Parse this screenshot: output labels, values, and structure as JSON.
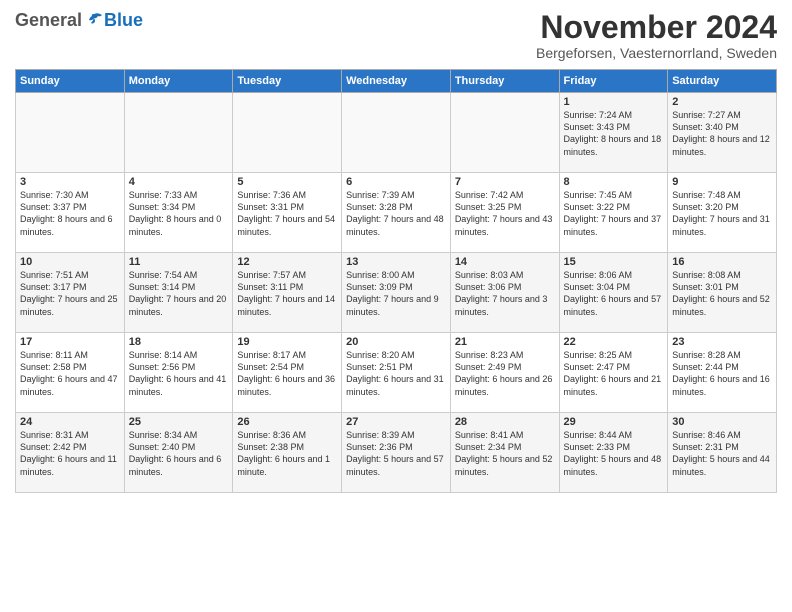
{
  "logo": {
    "general": "General",
    "blue": "Blue"
  },
  "title": "November 2024",
  "location": "Bergeforsen, Vaesternorrland, Sweden",
  "weekdays": [
    "Sunday",
    "Monday",
    "Tuesday",
    "Wednesday",
    "Thursday",
    "Friday",
    "Saturday"
  ],
  "weeks": [
    [
      {
        "day": "",
        "info": ""
      },
      {
        "day": "",
        "info": ""
      },
      {
        "day": "",
        "info": ""
      },
      {
        "day": "",
        "info": ""
      },
      {
        "day": "",
        "info": ""
      },
      {
        "day": "1",
        "info": "Sunrise: 7:24 AM\nSunset: 3:43 PM\nDaylight: 8 hours and 18 minutes."
      },
      {
        "day": "2",
        "info": "Sunrise: 7:27 AM\nSunset: 3:40 PM\nDaylight: 8 hours and 12 minutes."
      }
    ],
    [
      {
        "day": "3",
        "info": "Sunrise: 7:30 AM\nSunset: 3:37 PM\nDaylight: 8 hours and 6 minutes."
      },
      {
        "day": "4",
        "info": "Sunrise: 7:33 AM\nSunset: 3:34 PM\nDaylight: 8 hours and 0 minutes."
      },
      {
        "day": "5",
        "info": "Sunrise: 7:36 AM\nSunset: 3:31 PM\nDaylight: 7 hours and 54 minutes."
      },
      {
        "day": "6",
        "info": "Sunrise: 7:39 AM\nSunset: 3:28 PM\nDaylight: 7 hours and 48 minutes."
      },
      {
        "day": "7",
        "info": "Sunrise: 7:42 AM\nSunset: 3:25 PM\nDaylight: 7 hours and 43 minutes."
      },
      {
        "day": "8",
        "info": "Sunrise: 7:45 AM\nSunset: 3:22 PM\nDaylight: 7 hours and 37 minutes."
      },
      {
        "day": "9",
        "info": "Sunrise: 7:48 AM\nSunset: 3:20 PM\nDaylight: 7 hours and 31 minutes."
      }
    ],
    [
      {
        "day": "10",
        "info": "Sunrise: 7:51 AM\nSunset: 3:17 PM\nDaylight: 7 hours and 25 minutes."
      },
      {
        "day": "11",
        "info": "Sunrise: 7:54 AM\nSunset: 3:14 PM\nDaylight: 7 hours and 20 minutes."
      },
      {
        "day": "12",
        "info": "Sunrise: 7:57 AM\nSunset: 3:11 PM\nDaylight: 7 hours and 14 minutes."
      },
      {
        "day": "13",
        "info": "Sunrise: 8:00 AM\nSunset: 3:09 PM\nDaylight: 7 hours and 9 minutes."
      },
      {
        "day": "14",
        "info": "Sunrise: 8:03 AM\nSunset: 3:06 PM\nDaylight: 7 hours and 3 minutes."
      },
      {
        "day": "15",
        "info": "Sunrise: 8:06 AM\nSunset: 3:04 PM\nDaylight: 6 hours and 57 minutes."
      },
      {
        "day": "16",
        "info": "Sunrise: 8:08 AM\nSunset: 3:01 PM\nDaylight: 6 hours and 52 minutes."
      }
    ],
    [
      {
        "day": "17",
        "info": "Sunrise: 8:11 AM\nSunset: 2:58 PM\nDaylight: 6 hours and 47 minutes."
      },
      {
        "day": "18",
        "info": "Sunrise: 8:14 AM\nSunset: 2:56 PM\nDaylight: 6 hours and 41 minutes."
      },
      {
        "day": "19",
        "info": "Sunrise: 8:17 AM\nSunset: 2:54 PM\nDaylight: 6 hours and 36 minutes."
      },
      {
        "day": "20",
        "info": "Sunrise: 8:20 AM\nSunset: 2:51 PM\nDaylight: 6 hours and 31 minutes."
      },
      {
        "day": "21",
        "info": "Sunrise: 8:23 AM\nSunset: 2:49 PM\nDaylight: 6 hours and 26 minutes."
      },
      {
        "day": "22",
        "info": "Sunrise: 8:25 AM\nSunset: 2:47 PM\nDaylight: 6 hours and 21 minutes."
      },
      {
        "day": "23",
        "info": "Sunrise: 8:28 AM\nSunset: 2:44 PM\nDaylight: 6 hours and 16 minutes."
      }
    ],
    [
      {
        "day": "24",
        "info": "Sunrise: 8:31 AM\nSunset: 2:42 PM\nDaylight: 6 hours and 11 minutes."
      },
      {
        "day": "25",
        "info": "Sunrise: 8:34 AM\nSunset: 2:40 PM\nDaylight: 6 hours and 6 minutes."
      },
      {
        "day": "26",
        "info": "Sunrise: 8:36 AM\nSunset: 2:38 PM\nDaylight: 6 hours and 1 minute."
      },
      {
        "day": "27",
        "info": "Sunrise: 8:39 AM\nSunset: 2:36 PM\nDaylight: 5 hours and 57 minutes."
      },
      {
        "day": "28",
        "info": "Sunrise: 8:41 AM\nSunset: 2:34 PM\nDaylight: 5 hours and 52 minutes."
      },
      {
        "day": "29",
        "info": "Sunrise: 8:44 AM\nSunset: 2:33 PM\nDaylight: 5 hours and 48 minutes."
      },
      {
        "day": "30",
        "info": "Sunrise: 8:46 AM\nSunset: 2:31 PM\nDaylight: 5 hours and 44 minutes."
      }
    ]
  ]
}
